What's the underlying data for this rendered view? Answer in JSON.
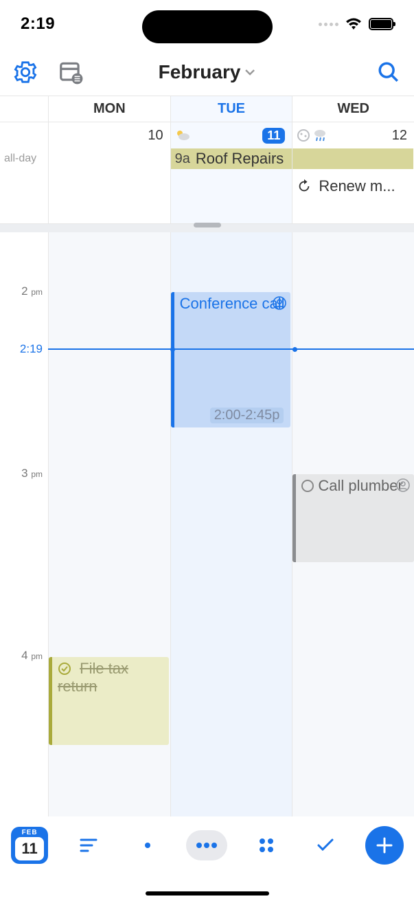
{
  "status": {
    "time": "2:19"
  },
  "header": {
    "title": "February"
  },
  "days": {
    "labels": [
      "MON",
      "TUE",
      "WED"
    ],
    "numbers": [
      "10",
      "11",
      "12"
    ]
  },
  "allday": {
    "label": "all-day",
    "roof": {
      "start": "9a",
      "title": "Roof Repairs"
    },
    "renew": {
      "title": "Renew m..."
    }
  },
  "grid": {
    "hours": [
      "2",
      "3",
      "4"
    ],
    "ampm": "pm",
    "now": "2:19"
  },
  "events": {
    "conference": {
      "title": "Conference call",
      "time": "2:00-2:45p"
    },
    "plumber": {
      "title": "Call plumber"
    },
    "tax": {
      "title": "File tax return"
    }
  },
  "toolbar": {
    "todayMonth": "FEB",
    "todayDay": "11"
  }
}
